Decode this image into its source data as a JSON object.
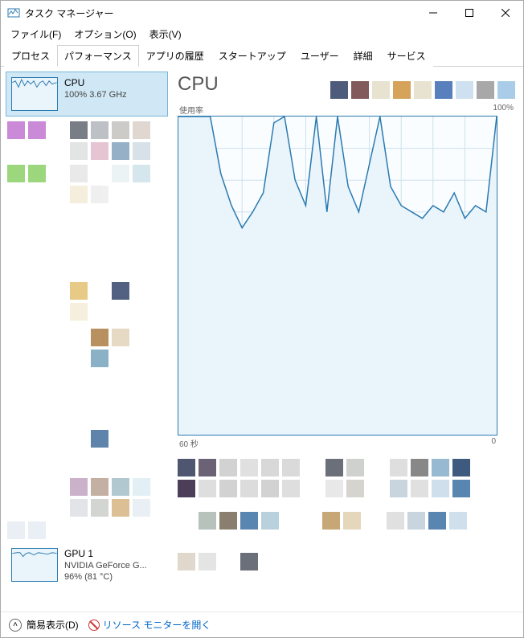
{
  "window": {
    "title": "タスク マネージャー"
  },
  "menu": {
    "file": "ファイル(F)",
    "options": "オプション(O)",
    "view": "表示(V)"
  },
  "tabs": {
    "processes": "プロセス",
    "performance": "パフォーマンス",
    "apphistory": "アプリの履歴",
    "startup": "スタートアップ",
    "users": "ユーザー",
    "details": "詳細",
    "services": "サービス"
  },
  "sidebar": {
    "cpu": {
      "name": "CPU",
      "sub": "100%  3.67 GHz"
    },
    "gpu1": {
      "name": "GPU 1",
      "sub1": "NVIDIA GeForce G...",
      "sub2": "96%  (81 °C)"
    }
  },
  "main": {
    "title": "CPU",
    "util_label": "使用率",
    "util_max": "100%",
    "xaxis_left": "60 秒",
    "xaxis_right": "0"
  },
  "footer": {
    "fewer": "簡易表示(D)",
    "resmon": "リソース モニターを開く"
  },
  "swatches": [
    "#4e5b7a",
    "#835a5b",
    "#e8e2d0",
    "#d6a35b",
    "#e8e2d0",
    "#5a7fbd",
    "#cfe0f0",
    "#a8a8a8",
    "#a9cde8"
  ],
  "chart_data": {
    "type": "line",
    "title": "使用率",
    "xlabel": "60 秒",
    "ylabel": "",
    "ylim": [
      0,
      100
    ],
    "x_seconds": [
      60,
      58,
      56,
      54,
      52,
      50,
      48,
      46,
      44,
      42,
      40,
      38,
      36,
      34,
      32,
      30,
      28,
      26,
      24,
      22,
      20,
      18,
      16,
      14,
      12,
      10,
      8,
      6,
      4,
      2,
      0
    ],
    "series": [
      {
        "name": "CPU",
        "values": [
          100,
          100,
          100,
          100,
          82,
          72,
          65,
          70,
          76,
          98,
          100,
          80,
          72,
          100,
          70,
          100,
          78,
          70,
          85,
          100,
          78,
          72,
          70,
          68,
          72,
          70,
          76,
          68,
          72,
          70,
          100
        ]
      }
    ]
  }
}
